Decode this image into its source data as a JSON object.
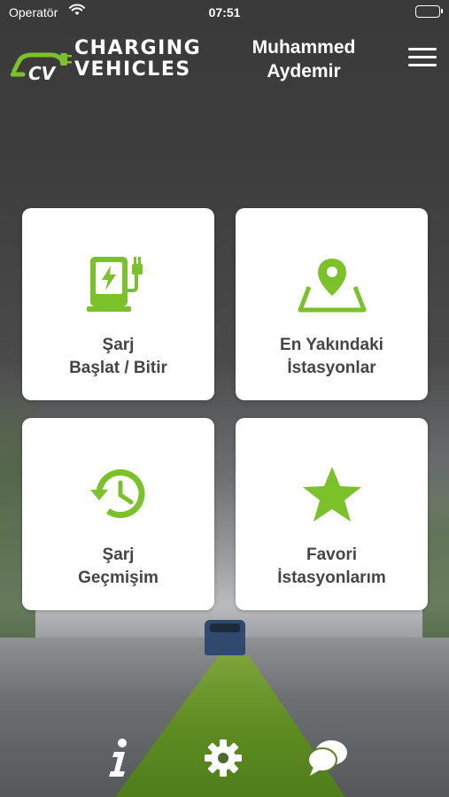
{
  "status_bar": {
    "carrier": "Operatör",
    "time": "07:51"
  },
  "header": {
    "logo_line1": "CHARGING",
    "logo_line2": "VEHICLES",
    "logo_mark": "CV",
    "user_first": "Muhammed",
    "user_last": "Aydemir"
  },
  "tiles": [
    {
      "line1": "Şarj",
      "line2": "Başlat / Bitir",
      "icon": "charging-station-icon"
    },
    {
      "line1": "En Yakındaki",
      "line2": "İstasyonlar",
      "icon": "map-pin-icon"
    },
    {
      "line1": "Şarj",
      "line2": "Geçmişim",
      "icon": "history-icon"
    },
    {
      "line1": "Favori",
      "line2": "İstasyonlarım",
      "icon": "star-icon"
    }
  ],
  "bottom_bar": {
    "info_icon": "info-icon",
    "settings_icon": "gear-icon",
    "chat_icon": "chat-icon"
  },
  "colors": {
    "accent": "#7ac12a",
    "tile_text": "#454545",
    "tile_bg": "#ffffff"
  }
}
